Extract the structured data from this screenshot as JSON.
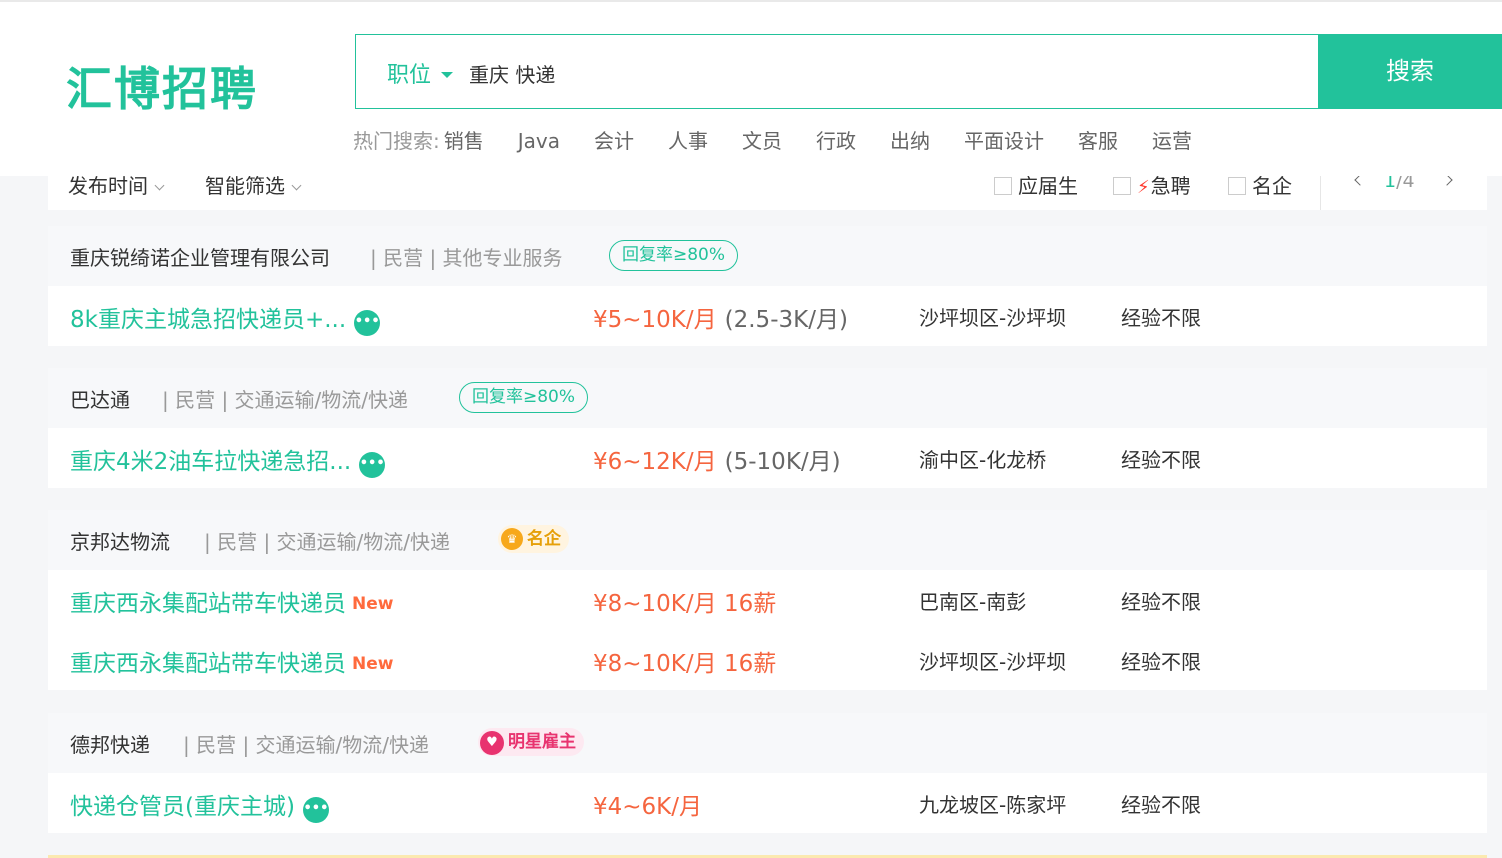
{
  "header": {
    "logo": "汇博招聘",
    "search": {
      "category": "职位",
      "query": "重庆 快递",
      "button": "搜索"
    },
    "hot": {
      "label": "热门搜索:",
      "keywords": [
        "销售",
        "Java",
        "会计",
        "人事",
        "文员",
        "行政",
        "出纳",
        "平面设计",
        "客服",
        "运营"
      ]
    }
  },
  "filters": {
    "time": "发布时间",
    "smart": "智能筛选",
    "checkboxes": [
      "应届生",
      "急聘",
      "名企"
    ],
    "pager": {
      "current": "1",
      "total": "/4"
    }
  },
  "companies": [
    {
      "name": "重庆锐绮诺企业管理有限公司",
      "meta": "| 民营 | 其他专业服务",
      "badge": "回复率≥80%",
      "jobs": [
        {
          "title": "8k重庆主城急招快递员+...",
          "salary": "¥5~10K/月",
          "salary_sub": "(2.5-3K/月)",
          "location": "沙坪坝区-沙坪坝",
          "experience": "经验不限"
        }
      ]
    },
    {
      "name": "巴达通",
      "meta": "| 民营 | 交通运输/物流/快递",
      "badge": "回复率≥80%",
      "jobs": [
        {
          "title": "重庆4米2油车拉快递急招...",
          "salary": "¥6~12K/月",
          "salary_sub": "(5-10K/月)",
          "location": "渝中区-化龙桥",
          "experience": "经验不限"
        }
      ]
    },
    {
      "name": "京邦达物流",
      "meta": "| 民营 | 交通运输/物流/快递",
      "badge": "名企",
      "jobs": [
        {
          "title": "重庆西永集配站带车快递员",
          "tag": "New",
          "salary": "¥8~10K/月 16薪",
          "location": "巴南区-南彭",
          "experience": "经验不限"
        },
        {
          "title": "重庆西永集配站带车快递员",
          "tag": "New",
          "salary": "¥8~10K/月 16薪",
          "location": "沙坪坝区-沙坪坝",
          "experience": "经验不限"
        }
      ]
    },
    {
      "name": "德邦快递",
      "meta": "| 民营 | 交通运输/物流/快递",
      "badge": "明星雇主",
      "jobs": [
        {
          "title": "快递仓管员(重庆主城)",
          "salary": "¥4~6K/月",
          "location": "九龙坡区-陈家坪",
          "experience": "经验不限"
        }
      ]
    }
  ],
  "colors": {
    "brand": "#22c29b",
    "salary": "#f5653f",
    "famous": "#e6a00a",
    "star": "#e8336f"
  },
  "icons": {
    "chat": "chat-bubble-icon",
    "crown": "crown-icon",
    "heart": "diamond-heart-icon",
    "bolt": "lightning-icon"
  }
}
